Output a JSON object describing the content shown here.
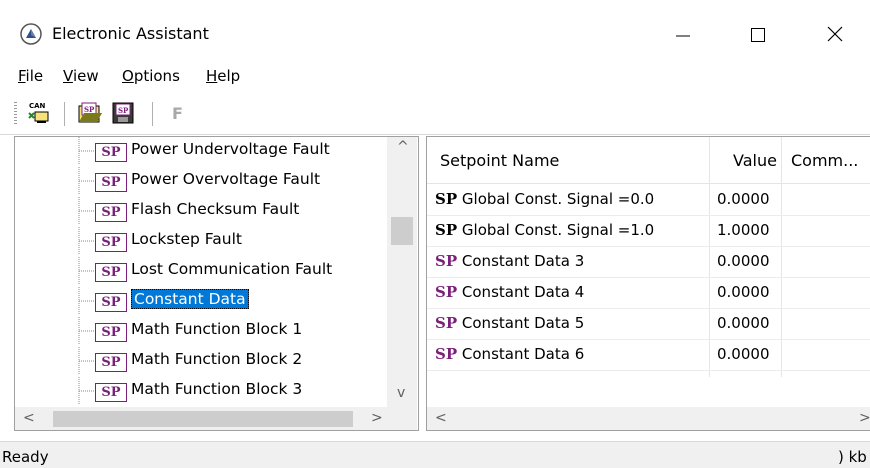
{
  "window": {
    "title": "Electronic Assistant",
    "controls": {
      "minimize": "minimize",
      "maximize": "maximize",
      "close": "close"
    }
  },
  "menu": [
    {
      "label": "File"
    },
    {
      "label": "View"
    },
    {
      "label": "Options"
    },
    {
      "label": "Help"
    }
  ],
  "toolbar": {
    "buttons": [
      "can-connect-icon",
      "open-setpoint-file-icon",
      "save-setpoint-file-icon"
    ],
    "f_label": "F"
  },
  "tree": {
    "badge": "SP",
    "items": [
      {
        "label": "Power Undervoltage Fault",
        "selected": false
      },
      {
        "label": "Power Overvoltage Fault",
        "selected": false
      },
      {
        "label": "Flash Checksum Fault",
        "selected": false
      },
      {
        "label": "Lockstep Fault",
        "selected": false
      },
      {
        "label": "Lost Communication Fault",
        "selected": false
      },
      {
        "label": "Constant Data",
        "selected": true
      },
      {
        "label": "Math Function Block 1",
        "selected": false
      },
      {
        "label": "Math Function Block 2",
        "selected": false
      },
      {
        "label": "Math Function Block 3",
        "selected": false
      }
    ]
  },
  "grid": {
    "columns": [
      "Setpoint Name",
      "Value",
      "Comm..."
    ],
    "rows": [
      {
        "tag": "SP",
        "name": "Global Const. Signal =0.0",
        "value": "0.0000",
        "tag_color": "#000000"
      },
      {
        "tag": "SP",
        "name": "Global Const. Signal =1.0",
        "value": "1.0000",
        "tag_color": "#000000"
      },
      {
        "tag": "SP",
        "name": "Constant Data 3",
        "value": "0.0000",
        "tag_color": "#7a1f7a"
      },
      {
        "tag": "SP",
        "name": "Constant Data 4",
        "value": "0.0000",
        "tag_color": "#7a1f7a"
      },
      {
        "tag": "SP",
        "name": "Constant Data 5",
        "value": "0.0000",
        "tag_color": "#7a1f7a"
      },
      {
        "tag": "SP",
        "name": "Constant Data 6",
        "value": "0.0000",
        "tag_color": "#7a1f7a"
      }
    ]
  },
  "status": {
    "text": "Ready",
    "right": ") kb"
  },
  "colors": {
    "selection": "#0078d7",
    "sp_badge": "#7a1f7a"
  }
}
